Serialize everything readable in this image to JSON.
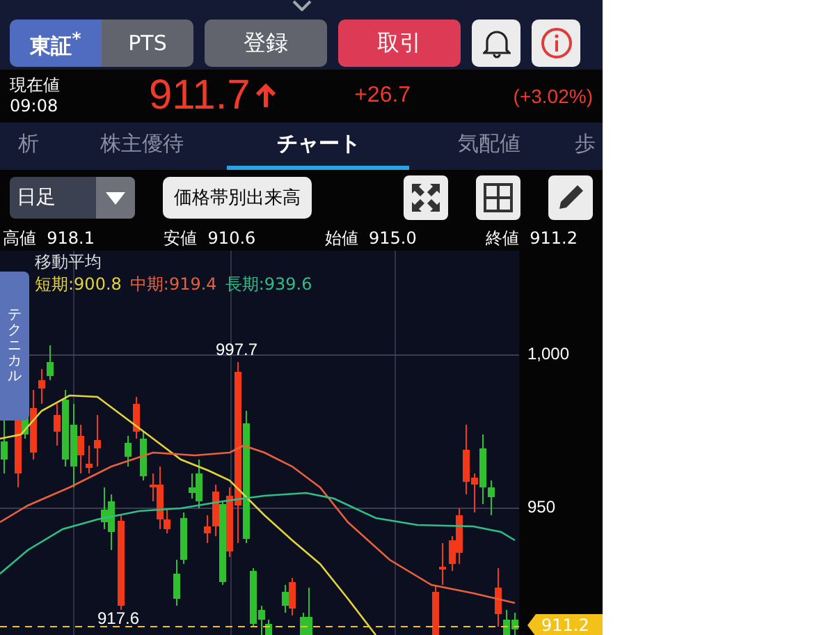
{
  "market_tabs": [
    {
      "label": "東証$^{*}$",
      "selected": true
    },
    {
      "label": "PTS",
      "selected": false
    }
  ],
  "actions": [
    {
      "label": "登録",
      "kind": "neutral"
    },
    {
      "label": "取引",
      "kind": "trade"
    }
  ],
  "quote": {
    "label": "現在値",
    "time": "09:08",
    "price": "911.7",
    "rising": true,
    "change": "+26.7",
    "change_pct": "(+3.02%)"
  },
  "tabs": [
    {
      "label": "析",
      "selected": false
    },
    {
      "label": "株主優待",
      "selected": false
    },
    {
      "label": "チャート",
      "selected": true
    },
    {
      "label": "気配値",
      "selected": false
    },
    {
      "label": "歩",
      "selected": false
    }
  ],
  "chart_controls": {
    "period": "日足",
    "volume_button": "価格帯別出来高"
  },
  "ohlc": [
    {
      "label": "高値",
      "value": "918.1"
    },
    {
      "label": "安値",
      "value": "910.6"
    },
    {
      "label": "始値",
      "value": "915.0"
    },
    {
      "label": "終値",
      "value": "911.2"
    }
  ],
  "chart": {
    "side_tab": "テクニカル",
    "legend_title": "移動平均",
    "moving_averages": [
      {
        "label": "短期:900.8",
        "color": "#e3d43a"
      },
      {
        "label": "中期:919.4",
        "color": "#e8603c"
      },
      {
        "label": "長期:939.6",
        "color": "#2fbf86"
      }
    ],
    "y_labels": [
      "1,000",
      "950"
    ],
    "high_label": "997.7",
    "low_label": "917.6",
    "current_price": "911.2"
  }
}
